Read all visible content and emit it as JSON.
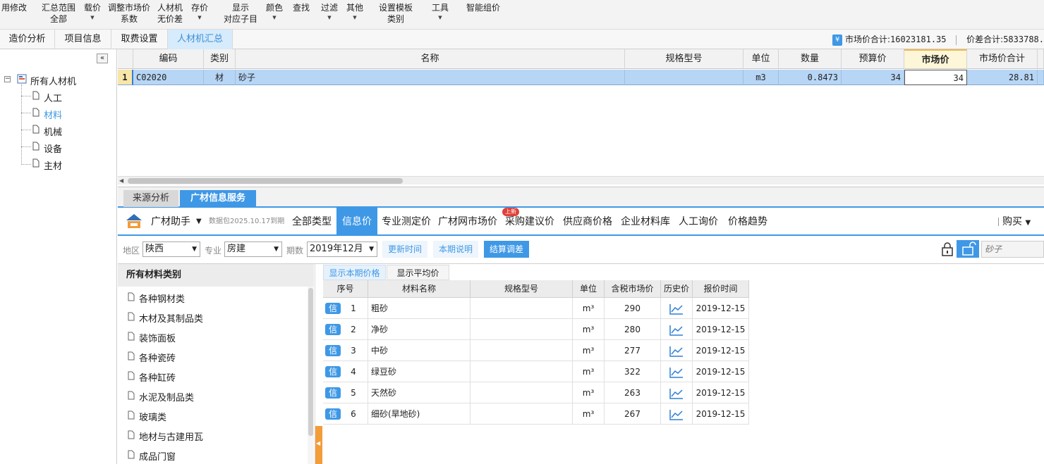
{
  "toolbar": {
    "items": [
      {
        "l1": "用修改",
        "l2": "",
        "caret": false
      },
      {
        "l1": "汇总范围",
        "l2": "全部",
        "caret": false
      },
      {
        "l1": "载价",
        "l2": "",
        "caret": true
      },
      {
        "l1": "调整市场价",
        "l2": "系数",
        "caret": false
      },
      {
        "l1": "人材机",
        "l2": "无价差",
        "caret": false
      },
      {
        "l1": "存价",
        "l2": "",
        "caret": true
      },
      {
        "l1": "显示",
        "l2": "对应子目",
        "caret": false
      },
      {
        "l1": "颜色",
        "l2": "",
        "caret": true
      },
      {
        "l1": "查找",
        "l2": "",
        "caret": false
      },
      {
        "l1": "过滤",
        "l2": "",
        "caret": true
      },
      {
        "l1": "其他",
        "l2": "",
        "caret": true
      },
      {
        "l1": "设置模板",
        "l2": "类别",
        "caret": false
      },
      {
        "l1": "工具",
        "l2": "",
        "caret": true
      },
      {
        "l1": "智能组价",
        "l2": "",
        "caret": false
      }
    ]
  },
  "tabs": [
    "造价分析",
    "项目信息",
    "取费设置",
    "人材机汇总"
  ],
  "sums": {
    "market_label": "市场价合计:",
    "market_value": "16023181.35",
    "diff_label": "价差合计:",
    "diff_value": "5833788."
  },
  "tree": {
    "collapse": "«",
    "root": "所有人材机",
    "children": [
      "人工",
      "材料",
      "机械",
      "设备",
      "主材"
    ]
  },
  "grid": {
    "headers": [
      "编码",
      "类别",
      "名称",
      "规格型号",
      "单位",
      "数量",
      "预算价",
      "市场价",
      "市场价合计"
    ],
    "row": {
      "num": "1",
      "code": "C02020",
      "type": "材",
      "name": "砂子",
      "spec": "",
      "unit": "m3",
      "qty": "0.8473",
      "budget": "34",
      "market": "34",
      "total": "28.81"
    }
  },
  "bottom_tabs": [
    "来源分析",
    "广材信息服务"
  ],
  "nav": {
    "brand": "广材助手",
    "package": "数据包2025.10.17到期",
    "items": [
      "全部类型",
      "信息价",
      "专业测定价",
      "广材网市场价",
      "采购建议价",
      "供应商价格",
      "企业材料库",
      "人工询价",
      "价格趋势"
    ],
    "badge": "上新",
    "buy": "购买"
  },
  "filters": {
    "region_label": "地区",
    "region": "陕西",
    "major_label": "专业",
    "major": "房建",
    "period_label": "期数",
    "period": "2019年12月",
    "btn_update": "更新时间",
    "btn_note": "本期说明",
    "btn_adjust": "结算调差",
    "search_placeholder": "砂子"
  },
  "categories": {
    "title": "所有材料类别",
    "items": [
      "各种钢材类",
      "木材及其制品类",
      "装饰面板",
      "各种瓷砖",
      "各种缸砖",
      "水泥及制品类",
      "玻璃类",
      "地材与古建用瓦",
      "成品门窗"
    ]
  },
  "price_tabs": [
    "显示本期价格",
    "显示平均价"
  ],
  "materials": {
    "headers": [
      "序号",
      "材料名称",
      "规格型号",
      "单位",
      "含税市场价",
      "历史价",
      "报价时间"
    ],
    "tag": "信",
    "rows": [
      {
        "no": "1",
        "name": "粗砂",
        "spec": "",
        "unit": "m³",
        "price": "290",
        "date": "2019-12-15"
      },
      {
        "no": "2",
        "name": "净砂",
        "spec": "",
        "unit": "m³",
        "price": "280",
        "date": "2019-12-15"
      },
      {
        "no": "3",
        "name": "中砂",
        "spec": "",
        "unit": "m³",
        "price": "277",
        "date": "2019-12-15"
      },
      {
        "no": "4",
        "name": "绿豆砂",
        "spec": "",
        "unit": "m³",
        "price": "322",
        "date": "2019-12-15"
      },
      {
        "no": "5",
        "name": "天然砂",
        "spec": "",
        "unit": "m³",
        "price": "263",
        "date": "2019-12-15"
      },
      {
        "no": "6",
        "name": "细砂(旱地砂)",
        "spec": "",
        "unit": "m³",
        "price": "267",
        "date": "2019-12-15"
      }
    ]
  },
  "colors": {
    "accent": "#3e98e6",
    "selected_row": "#b7d6f5",
    "highlight_header": "#fdf6d8",
    "scroll_handle": "#f39c3a"
  }
}
